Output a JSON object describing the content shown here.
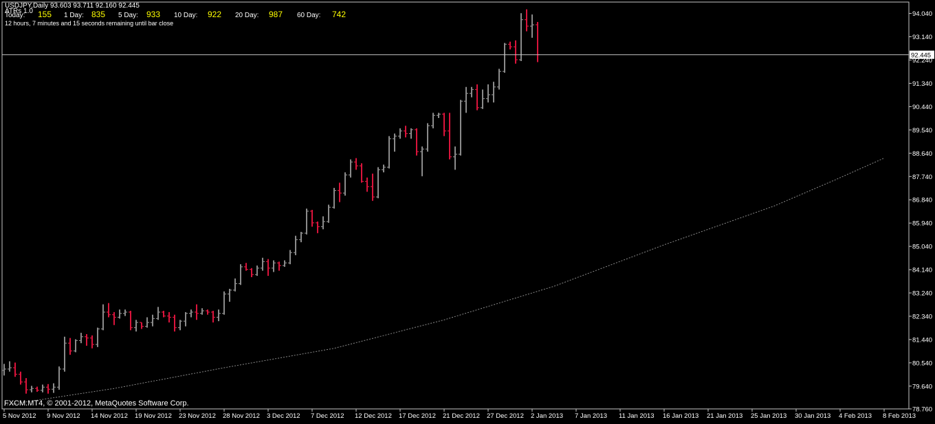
{
  "header": {
    "symbol_line": "USDJPY,Daily  93.603 93.711 92.160 92.445",
    "indicator_name": "ATRs 1.0",
    "remaining": "12 hours, 7 minutes and 15 seconds remaining until bar close"
  },
  "atr": {
    "today_label": "Today:",
    "today_value": "155",
    "d1_label": "1 Day:",
    "d1_value": "835",
    "d5_label": "5 Day:",
    "d5_value": "933",
    "d10_label": "10 Day:",
    "d10_value": "922",
    "d20_label": "20 Day:",
    "d20_value": "987",
    "d60_label": "60 Day:",
    "d60_value": "742"
  },
  "footer": {
    "copyright": "FXCM.MT4, © 2001-2012, MetaQuotes Software Corp."
  },
  "colors": {
    "background": "#000000",
    "up_bar": "#8c8c8c",
    "down_bar": "#dc143c",
    "price_line": "#c8c8c8",
    "ma": "#8c8c8c",
    "axis_text": "#ffffff",
    "atr_value": "#ffff00"
  },
  "chart_data": {
    "type": "ohlc",
    "symbol": "USDJPY",
    "timeframe": "Daily",
    "current_price": 92.445,
    "price_label": "92.445",
    "ylim": [
      78.76,
      94.48
    ],
    "y_ticks": [
      "94.040",
      "93.140",
      "92.240",
      "91.340",
      "90.440",
      "89.540",
      "88.640",
      "87.740",
      "86.840",
      "85.940",
      "85.040",
      "84.140",
      "83.240",
      "82.340",
      "81.440",
      "80.540",
      "79.640",
      "78.760"
    ],
    "x_ticks": [
      {
        "bar": 0,
        "label": "5 Nov 2012"
      },
      {
        "bar": 8,
        "label": "9 Nov 2012"
      },
      {
        "bar": 16,
        "label": "14 Nov 2012"
      },
      {
        "bar": 24,
        "label": "19 Nov 2012"
      },
      {
        "bar": 32,
        "label": "23 Nov 2012"
      },
      {
        "bar": 40,
        "label": "28 Nov 2012"
      },
      {
        "bar": 48,
        "label": "3 Dec 2012"
      },
      {
        "bar": 56,
        "label": "7 Dec 2012"
      },
      {
        "bar": 64,
        "label": "12 Dec 2012"
      },
      {
        "bar": 72,
        "label": "17 Dec 2012"
      },
      {
        "bar": 80,
        "label": "21 Dec 2012"
      },
      {
        "bar": 88,
        "label": "27 Dec 2012"
      },
      {
        "bar": 96,
        "label": "2 Jan 2013"
      },
      {
        "bar": 104,
        "label": "7 Jan 2013"
      },
      {
        "bar": 112,
        "label": "11 Jan 2013"
      },
      {
        "bar": 120,
        "label": "16 Jan 2013"
      },
      {
        "bar": 128,
        "label": "21 Jan 2013"
      },
      {
        "bar": 136,
        "label": "25 Jan 2013"
      },
      {
        "bar": 144,
        "label": "30 Jan 2013"
      },
      {
        "bar": 152,
        "label": "4 Feb 2013"
      },
      {
        "bar": 160,
        "label": "8 Feb 2013"
      }
    ],
    "bars": [
      [
        80.25,
        80.5,
        80.05,
        80.3
      ],
      [
        80.3,
        80.6,
        80.2,
        80.35
      ],
      [
        80.35,
        80.55,
        80.0,
        80.1
      ],
      [
        80.1,
        80.2,
        79.7,
        79.8
      ],
      [
        79.8,
        79.95,
        79.35,
        79.5
      ],
      [
        79.5,
        79.65,
        79.4,
        79.55
      ],
      [
        79.55,
        79.62,
        79.42,
        79.48
      ],
      [
        79.48,
        79.7,
        79.4,
        79.6
      ],
      [
        79.6,
        79.72,
        79.35,
        79.52
      ],
      [
        79.52,
        79.75,
        79.38,
        79.6
      ],
      [
        79.6,
        80.4,
        79.5,
        80.3
      ],
      [
        80.3,
        81.55,
        80.2,
        81.3
      ],
      [
        81.3,
        81.5,
        80.85,
        81.0
      ],
      [
        81.0,
        81.45,
        80.95,
        81.4
      ],
      [
        81.4,
        81.7,
        81.3,
        81.55
      ],
      [
        81.55,
        81.65,
        81.2,
        81.5
      ],
      [
        81.5,
        81.6,
        81.1,
        81.25
      ],
      [
        81.25,
        81.9,
        81.15,
        81.85
      ],
      [
        81.85,
        82.8,
        81.8,
        82.5
      ],
      [
        82.5,
        82.85,
        82.3,
        82.4
      ],
      [
        82.4,
        82.5,
        82.0,
        82.3
      ],
      [
        82.3,
        82.6,
        82.25,
        82.45
      ],
      [
        82.45,
        82.6,
        82.35,
        82.5
      ],
      [
        82.5,
        82.55,
        81.8,
        81.9
      ],
      [
        81.9,
        82.2,
        81.75,
        82.1
      ],
      [
        82.1,
        82.1,
        81.85,
        81.95
      ],
      [
        81.95,
        82.3,
        81.9,
        82.1
      ],
      [
        82.1,
        82.4,
        81.95,
        82.25
      ],
      [
        82.25,
        82.7,
        82.2,
        82.5
      ],
      [
        82.5,
        82.55,
        82.3,
        82.35
      ],
      [
        82.35,
        82.5,
        82.1,
        82.3
      ],
      [
        82.3,
        82.4,
        81.75,
        81.9
      ],
      [
        81.9,
        82.2,
        81.8,
        82.15
      ],
      [
        82.15,
        82.5,
        81.95,
        82.45
      ],
      [
        82.45,
        82.6,
        82.3,
        82.5
      ],
      [
        82.5,
        82.8,
        82.2,
        82.45
      ],
      [
        82.45,
        82.65,
        82.4,
        82.55
      ],
      [
        82.55,
        82.6,
        82.4,
        82.5
      ],
      [
        82.5,
        82.55,
        82.1,
        82.3
      ],
      [
        82.3,
        82.6,
        82.15,
        82.45
      ],
      [
        82.45,
        83.3,
        82.4,
        83.2
      ],
      [
        83.2,
        83.4,
        82.9,
        83.35
      ],
      [
        83.35,
        83.8,
        83.3,
        83.6
      ],
      [
        83.6,
        84.35,
        83.55,
        84.25
      ],
      [
        84.25,
        84.4,
        84.1,
        84.15
      ],
      [
        84.15,
        84.2,
        83.85,
        83.95
      ],
      [
        83.95,
        84.3,
        83.9,
        84.2
      ],
      [
        84.2,
        84.6,
        84.1,
        84.45
      ],
      [
        84.45,
        84.55,
        83.9,
        84.2
      ],
      [
        84.2,
        84.5,
        84.05,
        84.4
      ],
      [
        84.4,
        84.45,
        84.1,
        84.3
      ],
      [
        84.3,
        84.5,
        84.25,
        84.4
      ],
      [
        84.4,
        84.9,
        84.35,
        84.8
      ],
      [
        84.8,
        85.45,
        84.7,
        85.3
      ],
      [
        85.3,
        85.6,
        85.2,
        85.55
      ],
      [
        85.55,
        86.5,
        85.5,
        86.4
      ],
      [
        86.4,
        86.45,
        85.8,
        85.95
      ],
      [
        85.95,
        86.0,
        85.55,
        85.8
      ],
      [
        85.8,
        86.2,
        85.7,
        86.0
      ],
      [
        86.0,
        86.65,
        85.95,
        86.55
      ],
      [
        86.55,
        87.3,
        86.5,
        87.2
      ],
      [
        87.2,
        87.5,
        86.75,
        87.1
      ],
      [
        87.1,
        87.9,
        87.0,
        87.8
      ],
      [
        87.8,
        88.4,
        87.7,
        88.3
      ],
      [
        88.3,
        88.45,
        88.0,
        88.15
      ],
      [
        88.15,
        88.25,
        87.5,
        87.55
      ],
      [
        87.55,
        87.7,
        87.15,
        87.35
      ],
      [
        87.35,
        87.85,
        86.8,
        86.95
      ],
      [
        86.95,
        88.1,
        86.9,
        88.0
      ],
      [
        88.0,
        88.2,
        87.9,
        88.1
      ],
      [
        88.1,
        89.3,
        88.05,
        89.2
      ],
      [
        89.2,
        89.4,
        88.7,
        89.3
      ],
      [
        89.3,
        89.6,
        89.2,
        89.5
      ],
      [
        89.5,
        89.7,
        89.25,
        89.4
      ],
      [
        89.4,
        89.6,
        89.2,
        89.55
      ],
      [
        89.55,
        89.6,
        88.55,
        88.7
      ],
      [
        88.7,
        88.9,
        87.75,
        88.8
      ],
      [
        88.8,
        89.8,
        88.7,
        89.7
      ],
      [
        89.7,
        90.2,
        89.6,
        90.1
      ],
      [
        90.1,
        90.2,
        90.0,
        90.15
      ],
      [
        90.15,
        90.2,
        89.3,
        89.5
      ],
      [
        89.5,
        90.2,
        88.4,
        88.5
      ],
      [
        88.5,
        88.9,
        88.0,
        88.6
      ],
      [
        88.6,
        90.7,
        88.55,
        90.65
      ],
      [
        90.65,
        91.2,
        90.2,
        90.95
      ],
      [
        90.95,
        91.2,
        90.8,
        91.1
      ],
      [
        91.1,
        91.3,
        90.3,
        90.4
      ],
      [
        90.4,
        91.1,
        90.35,
        90.75
      ],
      [
        90.75,
        91.3,
        90.6,
        90.9
      ],
      [
        90.9,
        91.4,
        90.6,
        91.2
      ],
      [
        91.2,
        91.9,
        91.1,
        91.8
      ],
      [
        91.8,
        92.9,
        91.75,
        92.85
      ],
      [
        92.85,
        92.95,
        92.65,
        92.75
      ],
      [
        92.75,
        93.0,
        92.1,
        92.25
      ],
      [
        92.25,
        94.05,
        92.2,
        93.8
      ],
      [
        93.8,
        94.2,
        93.35,
        93.55
      ],
      [
        93.55,
        94.0,
        93.1,
        93.6
      ],
      [
        93.603,
        93.711,
        92.16,
        92.445
      ]
    ],
    "ma_anchors": [
      [
        0,
        78.9
      ],
      [
        20,
        79.55
      ],
      [
        40,
        80.35
      ],
      [
        60,
        81.1
      ],
      [
        80,
        82.2
      ],
      [
        100,
        83.5
      ],
      [
        120,
        85.1
      ],
      [
        140,
        86.6
      ],
      [
        151,
        87.6
      ],
      [
        160,
        88.45
      ]
    ]
  }
}
